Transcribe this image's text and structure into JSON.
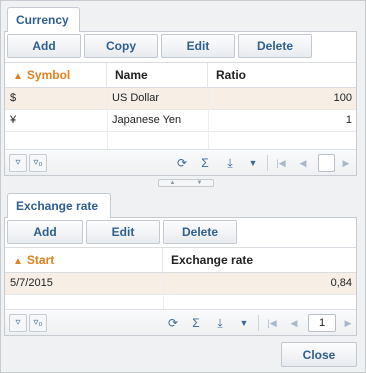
{
  "currency": {
    "tab_label": "Currency",
    "toolbar": {
      "add": "Add",
      "copy": "Copy",
      "edit": "Edit",
      "delete": "Delete"
    },
    "columns": {
      "symbol": "Symbol",
      "name": "Name",
      "ratio": "Ratio"
    },
    "rows": [
      {
        "symbol": "$",
        "name": "US Dollar",
        "ratio": "100"
      },
      {
        "symbol": "¥",
        "name": "Japanese Yen",
        "ratio": "1"
      }
    ],
    "footer": {
      "page_value": ""
    }
  },
  "exchange": {
    "tab_label": "Exchange rate",
    "toolbar": {
      "add": "Add",
      "edit": "Edit",
      "delete": "Delete"
    },
    "columns": {
      "start": "Start",
      "rate": "Exchange rate"
    },
    "rows": [
      {
        "start": "5/7/2015",
        "rate": "0,84"
      }
    ],
    "footer": {
      "page_value": "1"
    }
  },
  "dialog": {
    "close": "Close"
  },
  "icons": {
    "sort_asc": "▲",
    "filter": "filter-icon",
    "filter_clear": "filter-clear-icon",
    "refresh": "refresh-icon",
    "sum": "sum-icon",
    "export": "export-icon",
    "dropdown": "chevron-down-icon",
    "first": "first-page-icon",
    "prev": "prev-page-icon",
    "next": "next-page-icon",
    "last": "last-page-icon"
  },
  "colors": {
    "accent": "#2e5f8f",
    "sort": "#e0811e",
    "selected_row": "#f7efe6"
  }
}
